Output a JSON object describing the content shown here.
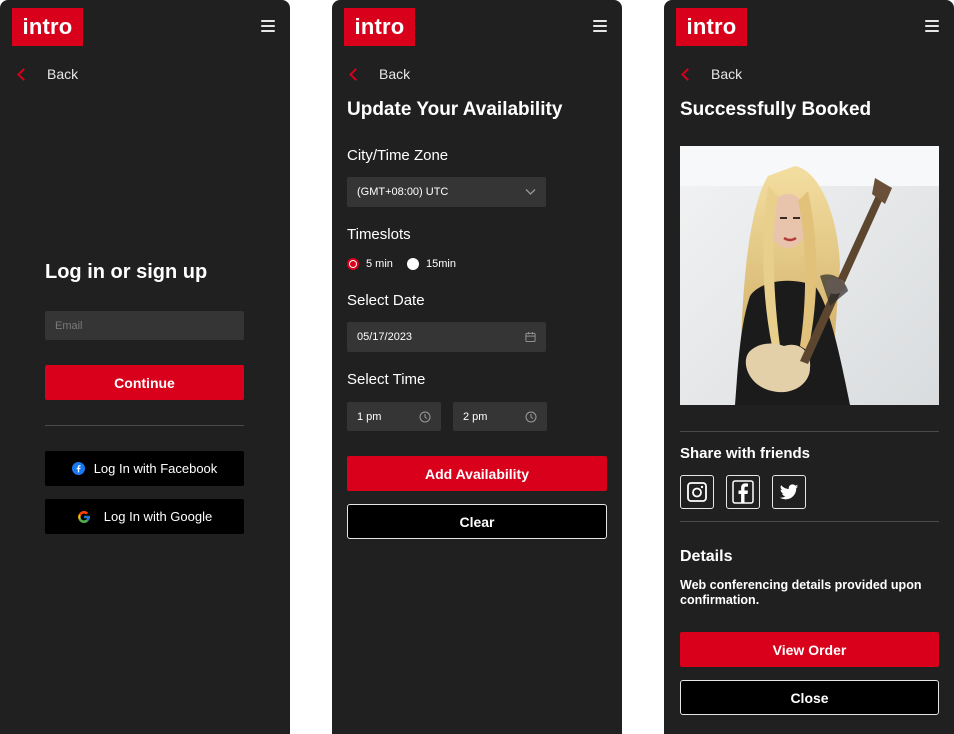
{
  "brand": {
    "logo_text": "intro",
    "accent_color": "#d8001a",
    "background": "#202020"
  },
  "common": {
    "back_label": "Back"
  },
  "login": {
    "title": "Log in or sign up",
    "email_placeholder": "Email",
    "continue_label": "Continue",
    "facebook_label": "Log In with Facebook",
    "google_label": "Log In with Google"
  },
  "availability": {
    "title": "Update Your Availability",
    "timezone_label": "City/Time Zone",
    "timezone_value": "(GMT+08:00) UTC",
    "timeslots_label": "Timeslots",
    "timeslot_options": [
      {
        "label": "5 min",
        "selected": true
      },
      {
        "label": "15min",
        "selected": false
      }
    ],
    "date_label": "Select Date",
    "date_value": "05/17/2023",
    "time_label": "Select Time",
    "start_time": "1 pm",
    "end_time": "2 pm",
    "add_label": "Add Availability",
    "clear_label": "Clear"
  },
  "booked": {
    "title": "Successfully Booked",
    "share_label": "Share with friends",
    "share_icons": [
      "instagram-icon",
      "facebook-icon",
      "twitter-icon"
    ],
    "details_label": "Details",
    "details_text": "Web conferencing details provided upon confirmation.",
    "view_order_label": "View Order",
    "close_label": "Close"
  }
}
